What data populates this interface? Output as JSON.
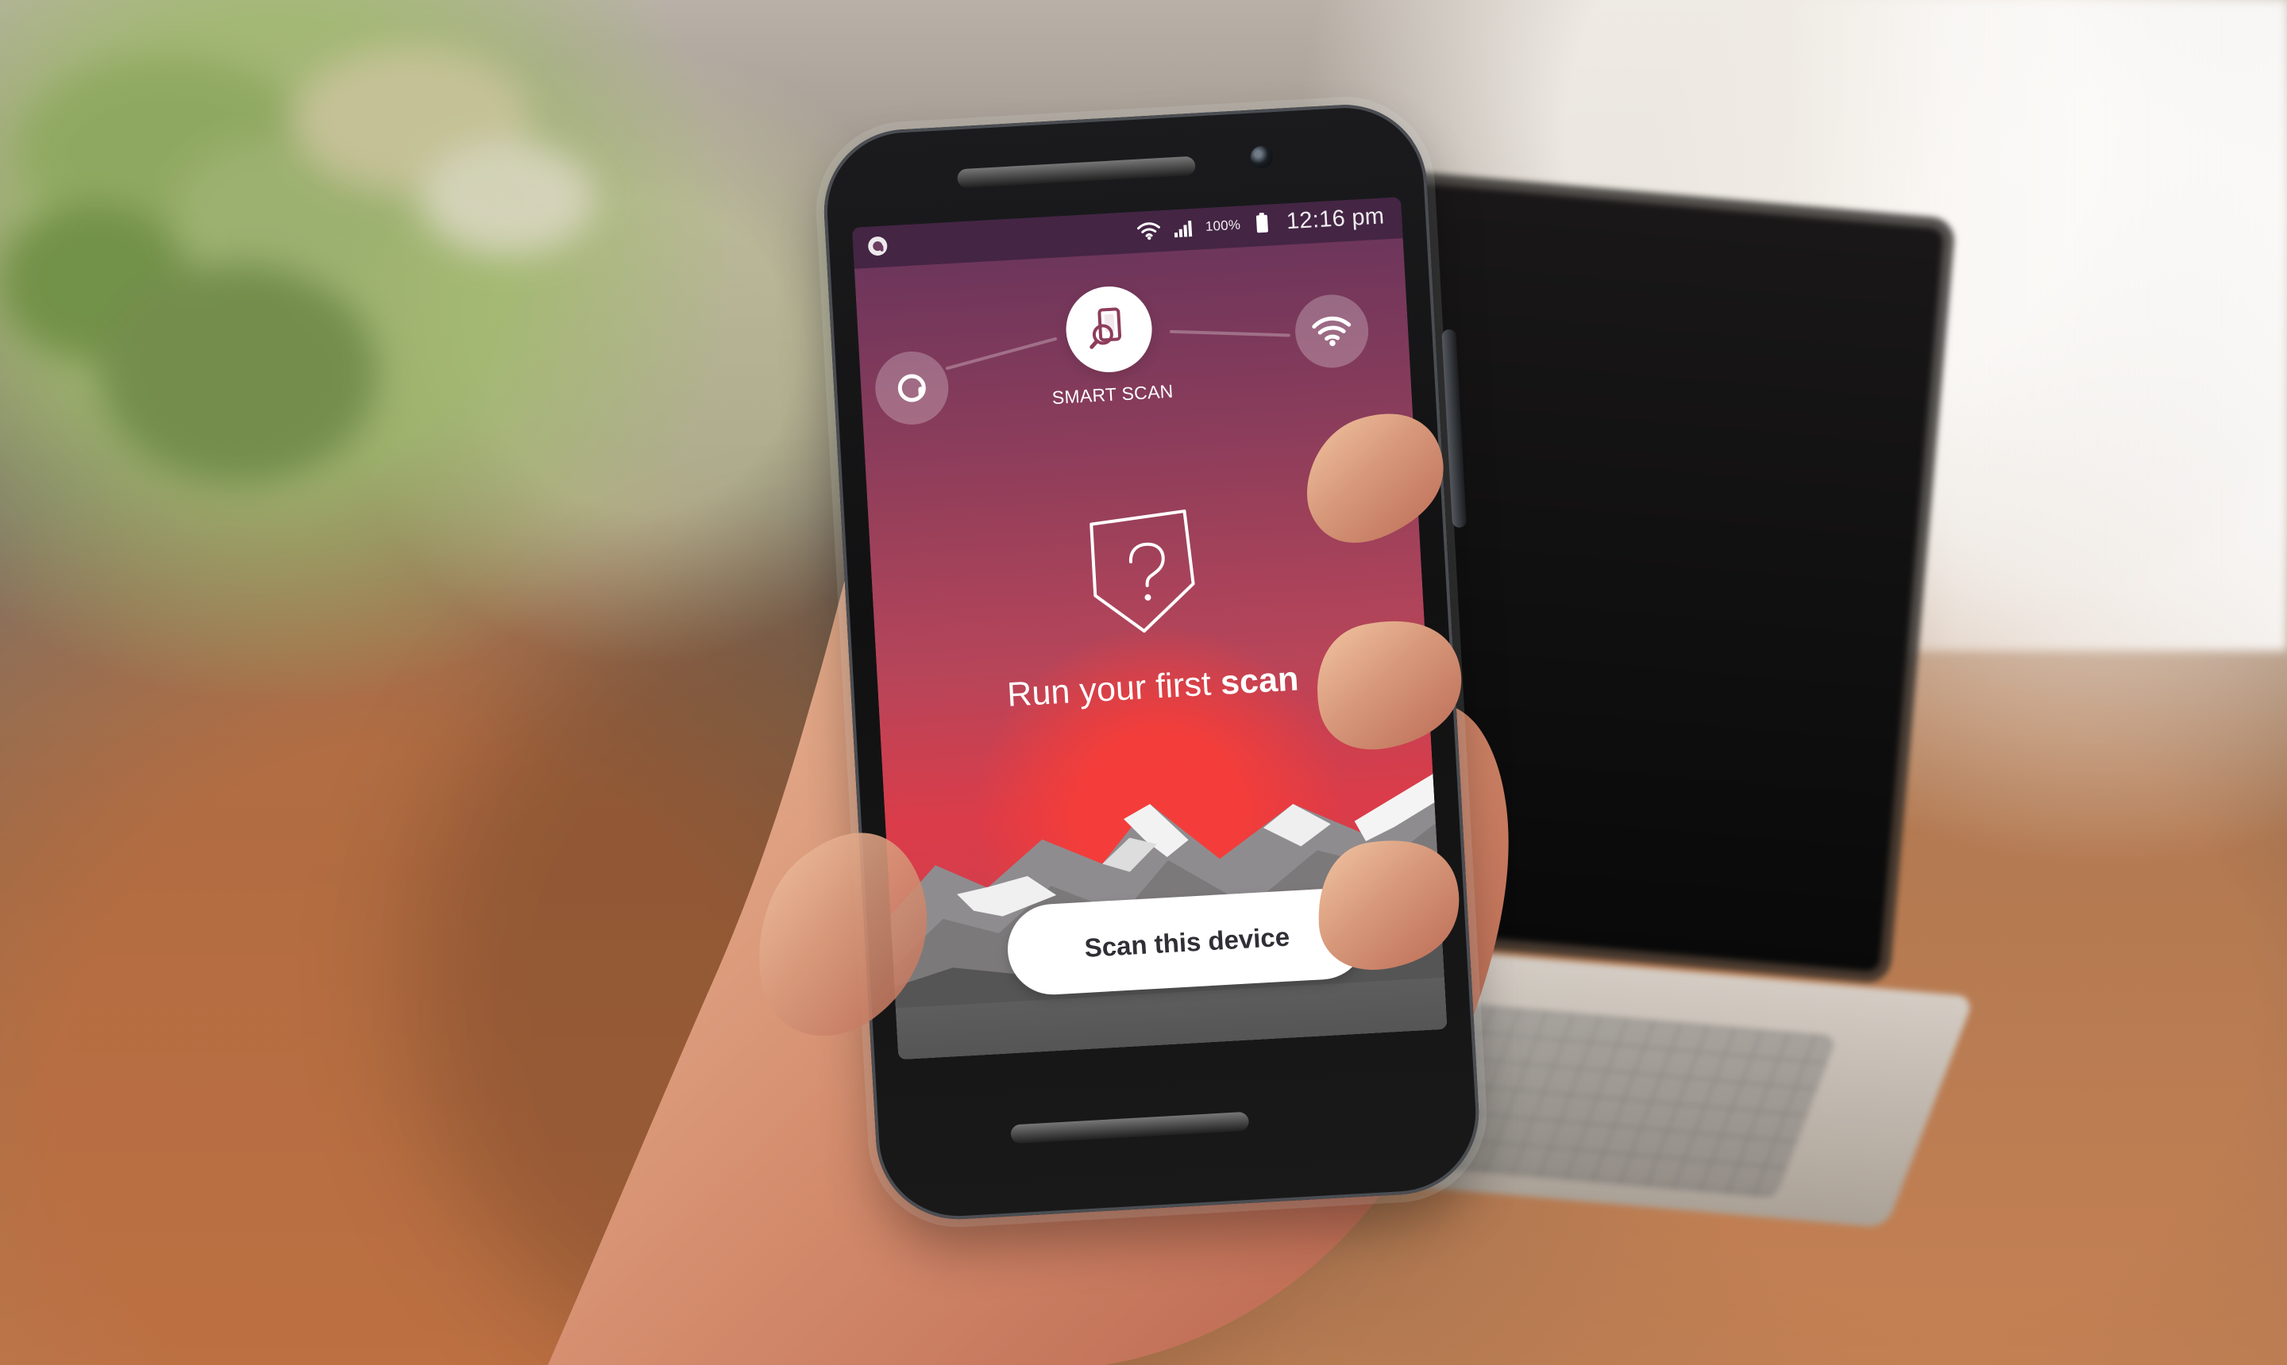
{
  "status_bar": {
    "battery_text": "100%",
    "time_text": "12:16 pm",
    "left_icon_name": "app-logo-icon",
    "right_icons": [
      "wifi-icon",
      "signal-icon",
      "battery-icon"
    ]
  },
  "app": {
    "top_button_label": "SMART SCAN",
    "top_button_icon": "device-search-icon",
    "left_node_icon": "app-logo-icon",
    "right_node_icon": "wifi-icon",
    "shield_icon": "question-shield-icon",
    "headline_part_1": "Run your first ",
    "headline_part_2": "scan",
    "primary_button_label": "Scan this device"
  },
  "colors": {
    "screen_top": "#67345b",
    "screen_mid": "#b74559",
    "screen_bottom": "#db3c49",
    "button_text": "#2f2f35",
    "mountain_gray": "#666666",
    "mountain_snow": "#f2f2f2"
  }
}
